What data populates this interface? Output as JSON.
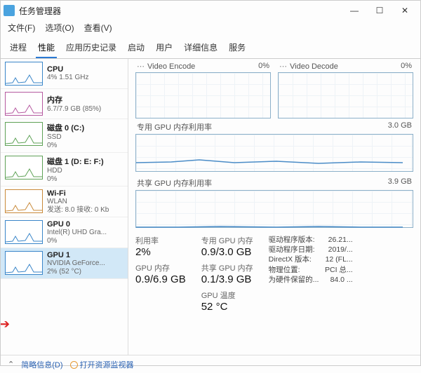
{
  "window": {
    "title": "任务管理器"
  },
  "menus": {
    "file": "文件(F)",
    "options": "选项(O)",
    "view": "查看(V)"
  },
  "tabs": [
    "进程",
    "性能",
    "应用历史记录",
    "启动",
    "用户",
    "详细信息",
    "服务"
  ],
  "active_tab": 1,
  "sidebar": [
    {
      "name": "CPU",
      "sub1": "4% 1.51 GHz",
      "color": "#3a86c9"
    },
    {
      "name": "内存",
      "sub1": "6.7/7.9 GB (85%)",
      "color": "#b65aa0"
    },
    {
      "name": "磁盘 0 (C:)",
      "sub1": "SSD",
      "sub2": "0%",
      "color": "#5fa257"
    },
    {
      "name": "磁盘 1 (D: E: F:)",
      "sub1": "HDD",
      "sub2": "0%",
      "color": "#5fa257"
    },
    {
      "name": "Wi-Fi",
      "sub1": "WLAN",
      "sub2": "发送: 8.0 接收: 0 Kb",
      "color": "#c98a3a"
    },
    {
      "name": "GPU 0",
      "sub1": "Intel(R) UHD Gra...",
      "sub2": "0%",
      "color": "#3a86c9"
    },
    {
      "name": "GPU 1",
      "sub1": "NVIDIA GeForce...",
      "sub2": "2% (52 °C)",
      "color": "#3a86c9",
      "selected": true
    }
  ],
  "detail": {
    "small_graphs": [
      {
        "label": "Video Encode",
        "right": "0%"
      },
      {
        "label": "Video Decode",
        "right": "0%"
      }
    ],
    "wide_graphs": [
      {
        "label": "专用 GPU 内存利用率",
        "right": "3.0 GB"
      },
      {
        "label": "共享 GPU 内存利用率",
        "right": "3.9 GB"
      }
    ],
    "stats": {
      "col1": [
        {
          "label": "利用率",
          "value": "2%"
        },
        {
          "label": "GPU 内存",
          "value": "0.9/6.9 GB"
        }
      ],
      "col2": [
        {
          "label": "专用 GPU 内存",
          "value": "0.9/3.0 GB"
        },
        {
          "label": "共享 GPU 内存",
          "value": "0.1/3.9 GB"
        },
        {
          "label": "GPU 温度",
          "value": "52 °C"
        }
      ]
    },
    "info": [
      {
        "k": "驱动程序版本:",
        "v": "26.21..."
      },
      {
        "k": "驱动程序日期:",
        "v": "2019/..."
      },
      {
        "k": "DirectX 版本:",
        "v": "12 (FL..."
      },
      {
        "k": "物理位置:",
        "v": "PCI 总..."
      },
      {
        "k": "为硬件保留的...",
        "v": "84.0 ..."
      }
    ]
  },
  "footer": {
    "brief": "简略信息(D)",
    "open_mon": "打开资源监视器"
  }
}
